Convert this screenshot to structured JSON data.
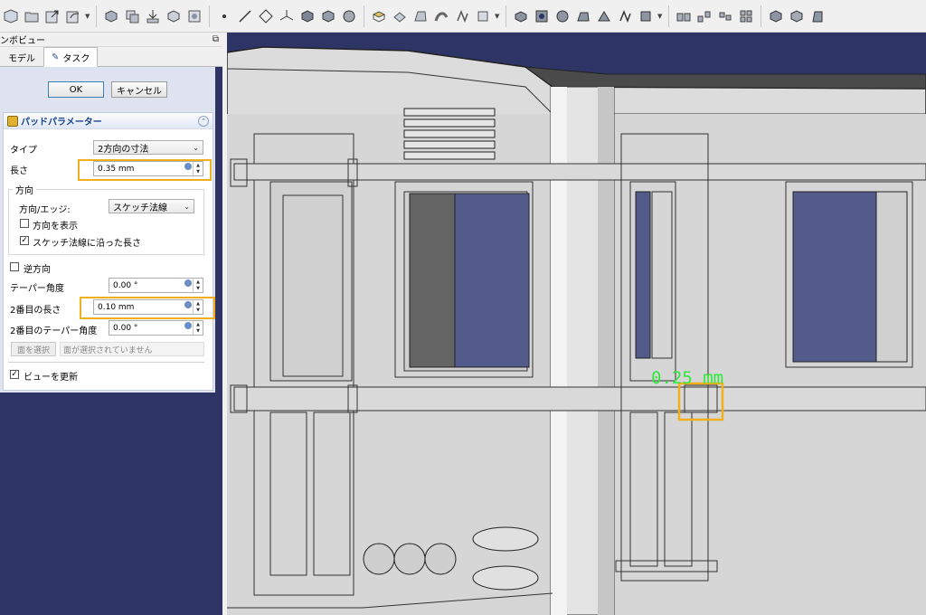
{
  "panel": {
    "header_title": "ンボビュー",
    "tabs": [
      {
        "label": "モデル"
      },
      {
        "label": "タスク"
      }
    ]
  },
  "dialog": {
    "ok_label": "OK",
    "cancel_label": "キャンセル"
  },
  "pad_params": {
    "title": "パッドパラメーター",
    "type_label": "タイプ",
    "type_value": "2方向の寸法",
    "length_label": "長さ",
    "length_value": "0.35 mm",
    "direction_group_title": "方向",
    "direction_edge_label": "方向/エッジ:",
    "direction_edge_value": "スケッチ法線",
    "show_direction_label": "方向を表示",
    "show_direction_checked": false,
    "along_normal_label": "スケッチ法線に沿った長さ",
    "along_normal_checked": true,
    "reversed_label": "逆方向",
    "reversed_checked": false,
    "taper_label": "テーパー角度",
    "taper_value": "0.00 °",
    "length2_label": "2番目の長さ",
    "length2_value": "0.10 mm",
    "taper2_label": "2番目のテーパー角度",
    "taper2_value": "0.00 °",
    "select_face_label": "面を選択",
    "select_face_status": "面が選択されていません",
    "update_view_label": "ビューを更新",
    "update_view_checked": true
  },
  "viewport": {
    "dimension_label": "0.25 mm",
    "background_color": "#2e3466",
    "highlight_color": "#f2b01e"
  }
}
